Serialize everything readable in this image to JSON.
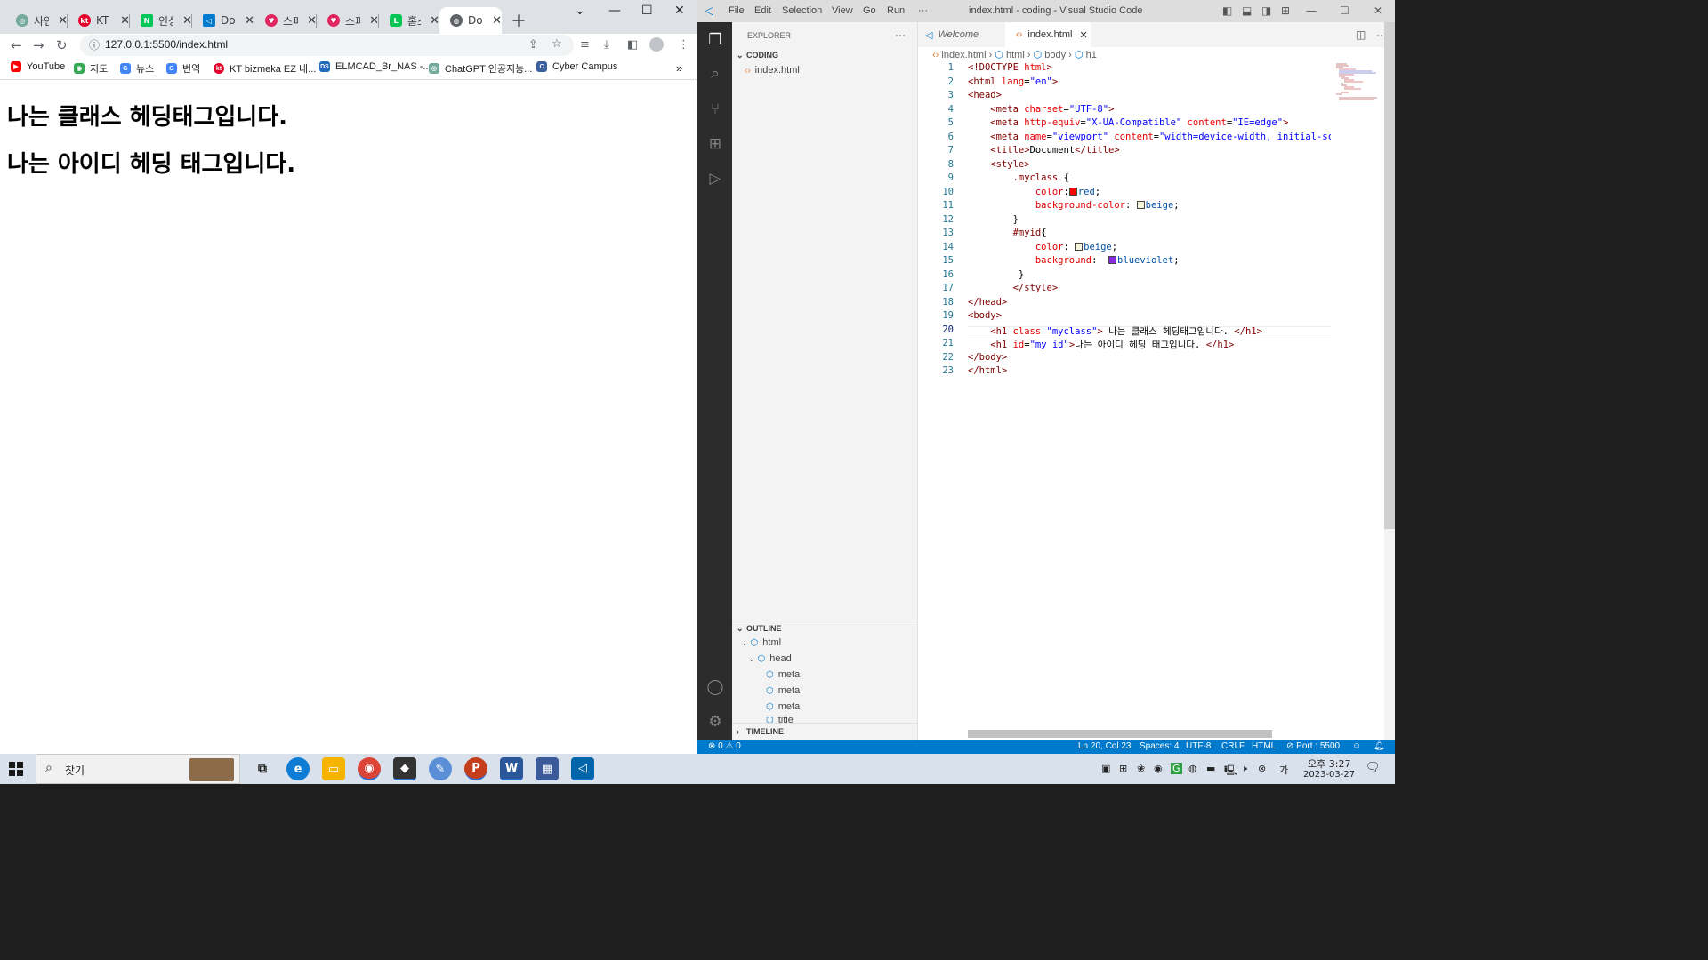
{
  "browser": {
    "tabs": [
      {
        "label": "사인",
        "icon": "chatgpt-icon",
        "color": "#74aa9c"
      },
      {
        "label": "KT",
        "icon": "kt-icon",
        "color": "#e4002b"
      },
      {
        "label": "인싱",
        "icon": "naver-icon",
        "color": "#03c75a"
      },
      {
        "label": "Doc",
        "icon": "vscode-icon",
        "color": "#007acc"
      },
      {
        "label": "스피",
        "icon": "heart-icon",
        "color": "#e0245e"
      },
      {
        "label": "스피",
        "icon": "heart-icon",
        "color": "#e0245e"
      },
      {
        "label": "홈스",
        "icon": "line-icon",
        "color": "#06c755"
      },
      {
        "label": "Doc",
        "icon": "globe-icon",
        "color": "#5f6368"
      }
    ],
    "url": "127.0.0.1:5500/index.html",
    "bookmarks": [
      {
        "label": "YouTube",
        "icon": "youtube-icon",
        "color": "#ff0000"
      },
      {
        "label": "지도",
        "icon": "maps-icon",
        "color": "#34a853"
      },
      {
        "label": "뉴스",
        "icon": "news-icon",
        "color": "#4285f4"
      },
      {
        "label": "번역",
        "icon": "translate-icon",
        "color": "#4285f4"
      },
      {
        "label": "KT bizmeka EZ 내...",
        "icon": "kt-icon",
        "color": "#e4002b"
      },
      {
        "label": "ELMCAD_Br_NAS -...",
        "icon": "dsm-icon",
        "color": "#1e6bb8"
      },
      {
        "label": "ChatGPT 인공지능...",
        "icon": "chatgpt-icon",
        "color": "#74aa9c"
      },
      {
        "label": "Cyber Campus",
        "icon": "campus-icon",
        "color": "#3a5f9f"
      }
    ],
    "more_bookmarks": "»",
    "page": {
      "heading1": "나는 클래스 헤딩태그입니다.",
      "heading2": "나는 아이디 헤딩 태그입니다."
    }
  },
  "vscode": {
    "menu": [
      "File",
      "Edit",
      "Selection",
      "View",
      "Go",
      "Run",
      "···"
    ],
    "title": "index.html - coding - Visual Studio Code",
    "explorer": {
      "header": "EXPLORER",
      "more": "···",
      "folder": "CODING",
      "file": "index.html"
    },
    "outline": {
      "header": "OUTLINE",
      "items": [
        "html",
        "head",
        "meta",
        "meta",
        "meta",
        "title"
      ]
    },
    "timeline": "TIMELINE",
    "tabs": {
      "welcome": "Welcome",
      "file": "index.html"
    },
    "breadcrumb": [
      "index.html",
      "html",
      "body",
      "h1"
    ],
    "line_numbers": [
      "1",
      "2",
      "3",
      "4",
      "5",
      "6",
      "7",
      "8",
      "9",
      "10",
      "11",
      "12",
      "13",
      "14",
      "15",
      "16",
      "17",
      "18",
      "19",
      "20",
      "21",
      "22",
      "23"
    ],
    "code": {
      "l1a": "<!DOCTYPE ",
      "l1b": "html",
      "l1c": ">",
      "l2a": "<html ",
      "l2b": "lang",
      "l2c": "=",
      "l2d": "\"en\"",
      "l2e": ">",
      "l3": "<head>",
      "l4a": "    <meta ",
      "l4b": "charset",
      "l4c": "=",
      "l4d": "\"UTF-8\"",
      "l4e": ">",
      "l5a": "    <meta ",
      "l5b": "http-equiv",
      "l5c": "=",
      "l5d": "\"X-UA-Compatible\"",
      "l5e": " content",
      "l5f": "=",
      "l5g": "\"IE=edge\"",
      "l5h": ">",
      "l6a": "    <meta ",
      "l6b": "name",
      "l6c": "=",
      "l6d": "\"viewport\"",
      "l6e": " content",
      "l6f": "=",
      "l6g": "\"width=device-width, initial-sc",
      "l7a": "    <title>",
      "l7b": "Document",
      "l7c": "</title>",
      "l8": "    <style>",
      "l9a": "        ",
      "l9b": ".myclass",
      "l9c": " {",
      "l10a": "            ",
      "l10b": "color",
      "l10c": ":",
      "l10d": "red",
      "l10e": ";",
      "l11a": "            ",
      "l11b": "background-color",
      "l11c": ": ",
      "l11d": "beige",
      "l11e": ";",
      "l12": "        }",
      "l13a": "        ",
      "l13b": "#myid",
      "l13c": "{",
      "l14a": "            ",
      "l14b": "color",
      "l14c": ": ",
      "l14d": "beige",
      "l14e": ";",
      "l15a": "            ",
      "l15b": "background",
      "l15c": ":  ",
      "l15d": "blueviolet",
      "l15e": ";",
      "l16": "         }",
      "l17": "        </style>",
      "l18": "</head>",
      "l19": "<body>",
      "l20a": "    <h1 ",
      "l20b": "class",
      "l20c": " ",
      "l20d": "\"myclass\"",
      "l20e": "> ",
      "l20f": "나는 클래스 헤딩태그입니다. ",
      "l20g": "</h1>",
      "l21a": "    <h1 ",
      "l21b": "id",
      "l21c": "=",
      "l21d": "\"my id\"",
      "l21e": ">",
      "l21f": "나는 아이디 헤딩 태그입니다. ",
      "l21g": "</h1>",
      "l22": "</body>",
      "l23": "</html>"
    },
    "swatches": {
      "red": "#ff0000",
      "beige": "#f5f5dc",
      "blueviolet": "#8a2be2"
    },
    "status": {
      "problems": "⊗ 0 ⚠ 0",
      "position": "Ln 20, Col 23",
      "spaces": "Spaces: 4",
      "encoding": "UTF-8",
      "eol": "CRLF",
      "language": "HTML",
      "port": "⊘ Port : 5500"
    }
  },
  "taskbar": {
    "search_label": "찾기",
    "apps": [
      {
        "name": "edge",
        "color": "#0c7cd5"
      },
      {
        "name": "file-explorer",
        "color": "#f4b400"
      },
      {
        "name": "chrome",
        "color": "#db4437"
      },
      {
        "name": "inkscape",
        "color": "#333333"
      },
      {
        "name": "paint",
        "color": "#5a8fd8"
      },
      {
        "name": "powerpoint",
        "color": "#c43e1c"
      },
      {
        "name": "word",
        "color": "#2b579a"
      },
      {
        "name": "calculator",
        "color": "#3c5a99"
      },
      {
        "name": "vscode",
        "color": "#0065a9"
      }
    ],
    "time": "오후 3:27",
    "date": "2023-03-27"
  }
}
